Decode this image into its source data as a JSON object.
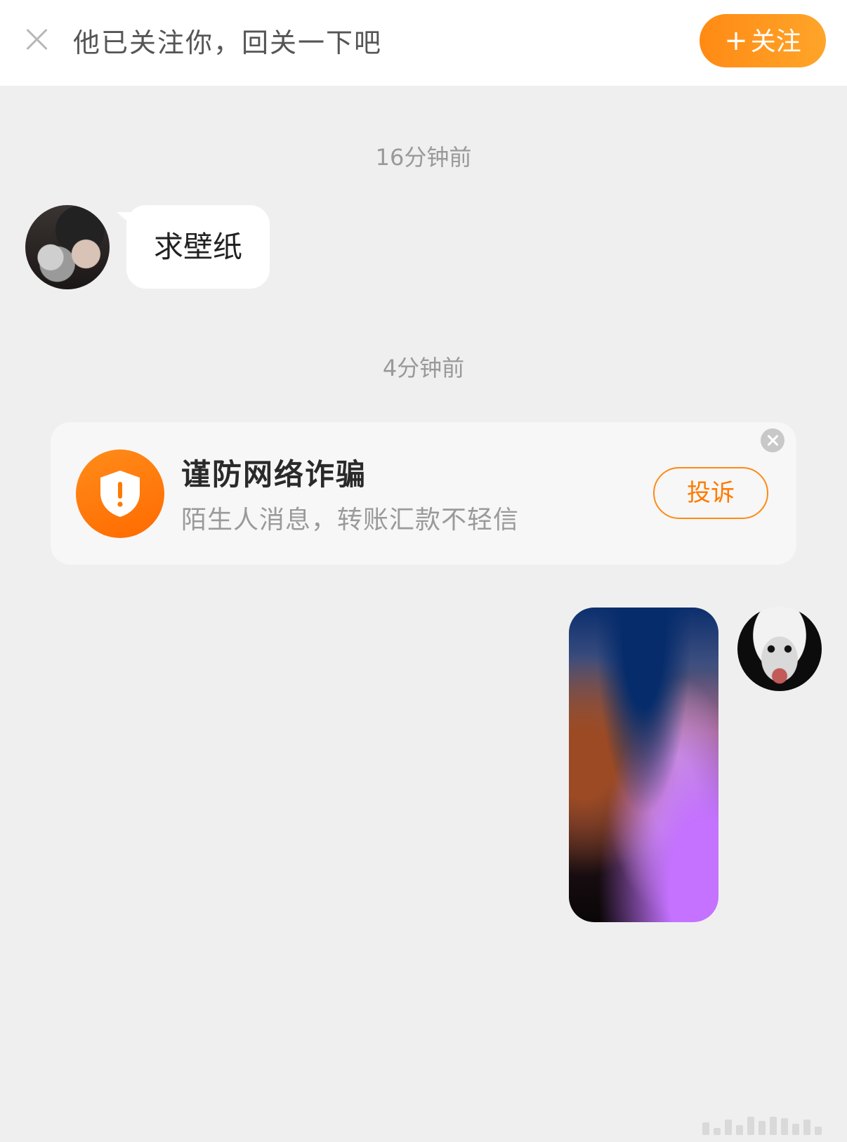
{
  "topbar": {
    "text": "他已关注你，回关一下吧",
    "follow_label": "关注",
    "follow_plus": "+"
  },
  "messages": {
    "timestamp_1": "16分钟前",
    "incoming_text": "求壁纸",
    "timestamp_2": "4分钟前"
  },
  "fraud_notice": {
    "title": "谨防网络诈骗",
    "subtitle": "陌生人消息，转账汇款不轻信",
    "report_label": "投诉"
  },
  "colors": {
    "accent": "#ff8a14",
    "background": "#efefef"
  },
  "icons": {
    "close": "close-icon",
    "shield": "shield-icon",
    "fraud_close": "close-circle-icon"
  }
}
